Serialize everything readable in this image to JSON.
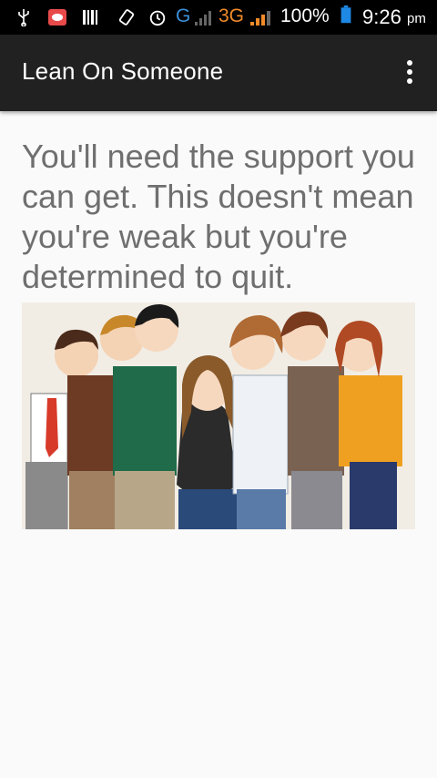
{
  "status_bar": {
    "network_g": "G",
    "network_3g": "3G",
    "battery": "100%",
    "time": "9:26",
    "time_suffix": "pm",
    "icons": [
      "usb-icon",
      "app-notification-icon",
      "barcode-icon",
      "rotate-icon",
      "alarm-icon",
      "signal-icon",
      "signal-icon",
      "battery-icon"
    ]
  },
  "app_bar": {
    "title": "Lean On Someone",
    "menu_icon": "overflow-menu-icon"
  },
  "main": {
    "message": "You'll need the support you can get. This doesn't mean you're weak but you're determined to quit.",
    "image": "group-of-friends-illustration"
  },
  "colors": {
    "status_bar": "#000000",
    "app_bar": "#212121",
    "background": "#fafafa",
    "text": "#6f6f6f",
    "g_label": "#3b8fd8",
    "three_g_label": "#f08a2a"
  }
}
